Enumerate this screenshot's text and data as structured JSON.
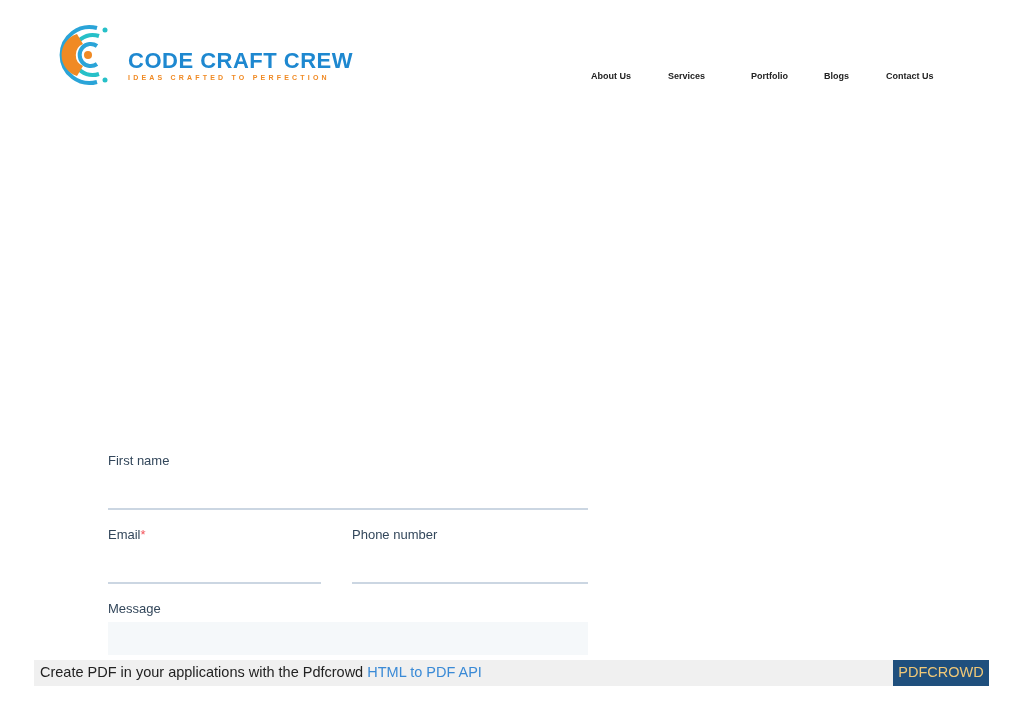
{
  "logo": {
    "name": "CODE CRAFT CREW",
    "tagline": "IDEAS CRAFTED TO PERFECTION"
  },
  "nav": [
    {
      "label": "About Us"
    },
    {
      "label": "Services"
    },
    {
      "label": "Portfolio"
    },
    {
      "label": "Blogs"
    },
    {
      "label": "Contact Us"
    }
  ],
  "form": {
    "first_name": {
      "label": "First name"
    },
    "email": {
      "label": "Email",
      "required_mark": "*"
    },
    "phone": {
      "label": "Phone number"
    },
    "message": {
      "label": "Message"
    }
  },
  "footer": {
    "text": "Create PDF in your applications with the Pdfcrowd ",
    "link": "HTML to PDF API",
    "button": "PDFCROWD"
  }
}
